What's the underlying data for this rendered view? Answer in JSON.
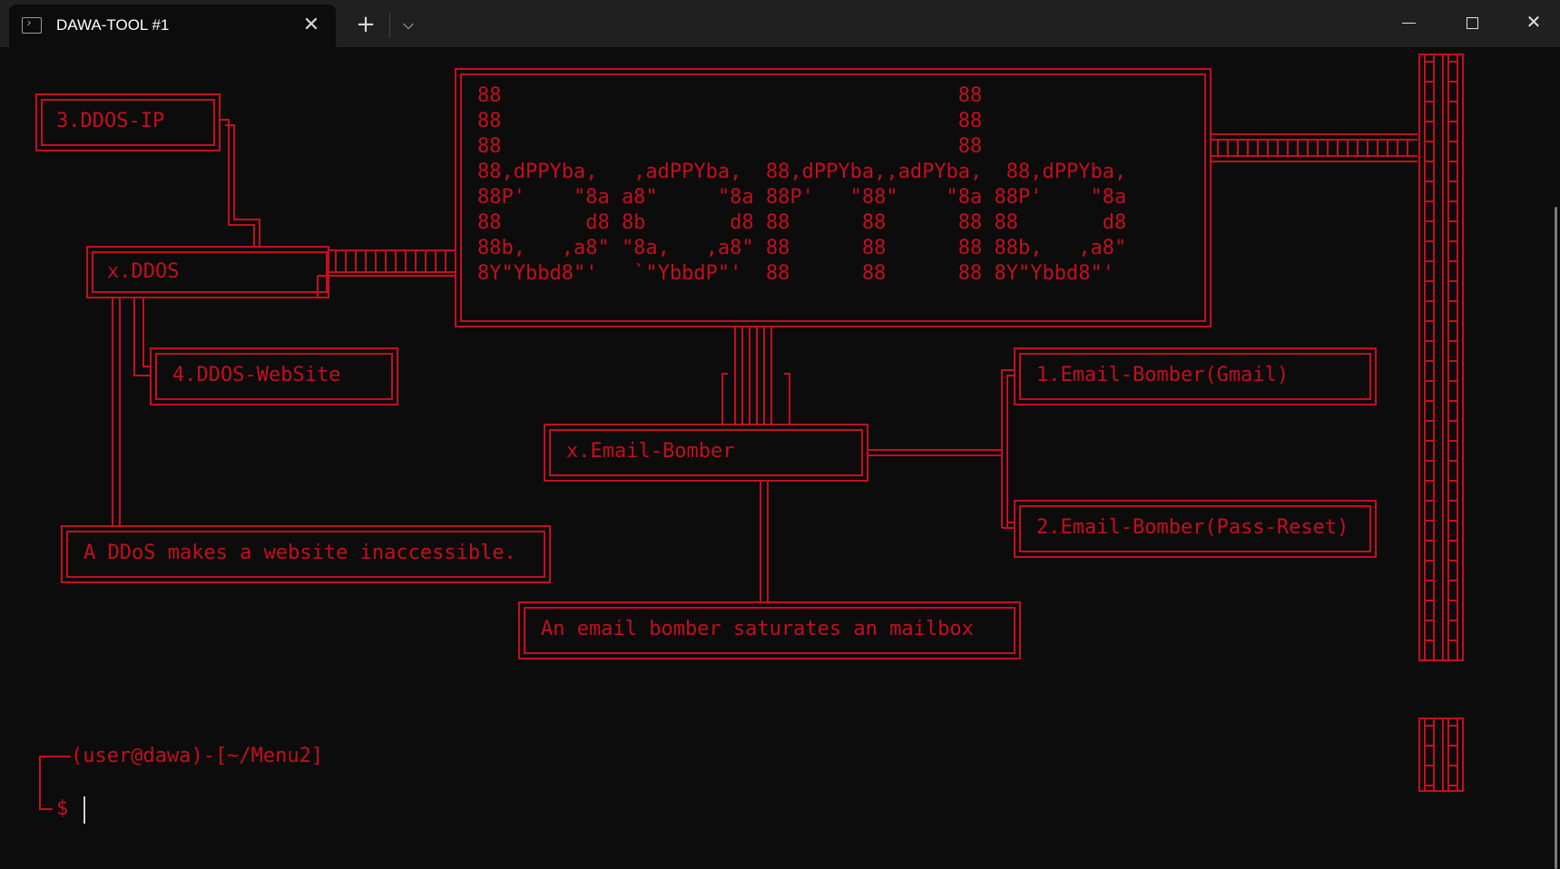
{
  "window": {
    "tab_title": "DAWA-TOOL #1",
    "tab_close_glyph": "✕",
    "new_tab_glyph": "+",
    "dropdown_glyph": "⌵",
    "close_glyph": "✕"
  },
  "menu": {
    "ddos_ip": "3.DDOS-IP",
    "ddos": "x.DDOS",
    "ddos_website": "4.DDOS-WebSite",
    "ddos_desc": "A DDoS makes a website inaccessible.",
    "email_bomber": "x.Email-Bomber",
    "email_gmail": "1.Email-Bomber(Gmail)",
    "email_pass_reset": "2.Email-Bomber(Pass-Reset)",
    "email_desc": "An email bomber saturates an mailbox"
  },
  "banner": "88                                      88\n88                                      88\n88                                      88\n88,dPPYba,   ,adPPYba,  88,dPPYba,,adPYba,  88,dPPYba,\n88P'    \"8a a8\"     \"8a 88P'   \"88\"    \"8a 88P'    \"8a\n88       d8 8b       d8 88      88      88 88       d8\n88b,   ,a8\" \"8a,   ,a8\" 88      88      88 88b,   ,a8\"\n8Y\"Ybbd8\"'   `\"YbbdP\"'  88      88      88 8Y\"Ybbd8\"'",
  "prompt": {
    "line1": "(user@dawa)-[~/Menu2]",
    "line2": "$"
  },
  "colors": {
    "accent_red": "#c50f1f",
    "background": "#0c0c0c",
    "titlebar": "#202020"
  }
}
